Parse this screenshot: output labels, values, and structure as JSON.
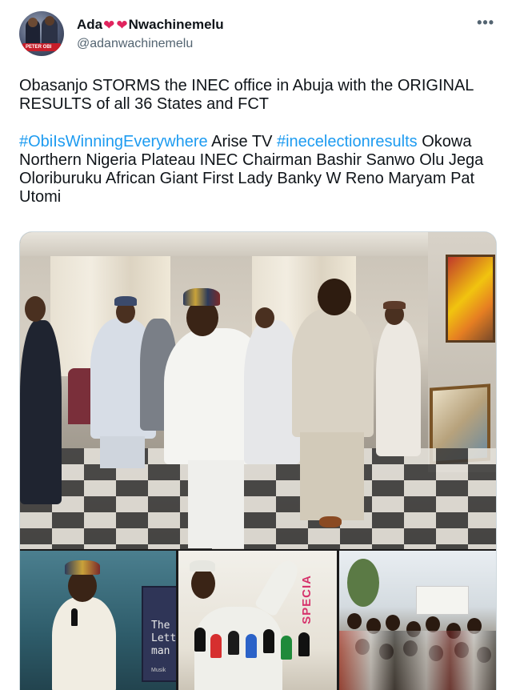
{
  "tweet": {
    "author": {
      "name_start": "Ada",
      "name_end": "Nwachinemelu",
      "heart_glyph": "❤",
      "handle": "@adanwachinemelu",
      "avatar_banner": "PETER OBI"
    },
    "more_glyph": "•••",
    "text": {
      "line1": "Obasanjo STORMS the INEC office in Abuja with the ORIGINAL RESULTS of all 36 States and FCT",
      "hashtag1": "#ObiIsWinningEverywhere",
      "plain1": " Arise TV ",
      "hashtag2": "#inecelectionresults",
      "plain2": " Okowa Northern Nigeria Plateau INEC Chairman Bashir Sanwo Olu Jega Oloriburuku African Giant First Lady Banky W Reno Maryam Pat Utomi"
    },
    "media": {
      "book_title": "The Lett man",
      "book_author": "Musik",
      "banner_text": "SPECIA"
    }
  },
  "colors": {
    "link": "#1d9bf0",
    "heart": "#e0245e",
    "secondary_text": "#536471"
  }
}
